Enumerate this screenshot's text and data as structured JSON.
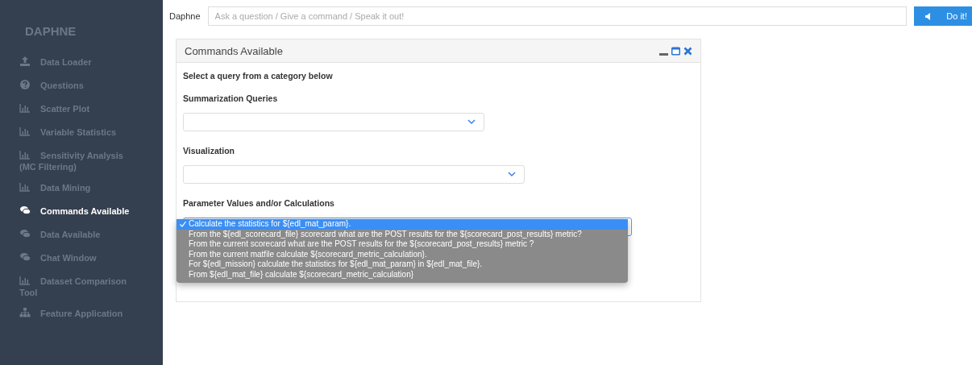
{
  "sidebar": {
    "title": "DAPHNE",
    "items": [
      {
        "label": "Data Loader",
        "kind": "upload",
        "selected": false
      },
      {
        "label": "Questions",
        "kind": "question",
        "selected": false
      },
      {
        "label": "Scatter Plot",
        "kind": "chart",
        "selected": false
      },
      {
        "label": "Variable Statistics",
        "kind": "chart",
        "selected": false
      },
      {
        "label": "Sensitivity Analysis (MC Filtering)",
        "kind": "chart",
        "selected": false
      },
      {
        "label": "Data Mining",
        "kind": "chart",
        "selected": false
      },
      {
        "label": "Commands Available",
        "kind": "comments",
        "selected": true
      },
      {
        "label": "Data Available",
        "kind": "comments",
        "selected": false
      },
      {
        "label": "Chat Window",
        "kind": "comments",
        "selected": false
      },
      {
        "label": "Dataset Comparison Tool",
        "kind": "chart",
        "selected": false
      },
      {
        "label": "Feature Application",
        "kind": "sitemap",
        "selected": false
      }
    ]
  },
  "command_bar": {
    "label": "Daphne",
    "placeholder": "Ask a question / Give a command / Speak it out!",
    "button": "Do it!"
  },
  "panel": {
    "title": "Commands Available",
    "intro": "Select a query from a category below",
    "categories": [
      {
        "label": "Summarization Queries",
        "expanded": false
      },
      {
        "label": "Visualization",
        "expanded": false
      },
      {
        "label": "Parameter Values and/or Calculations",
        "expanded": true,
        "options": [
          {
            "label": "Calculate the statistics for ${edl_mat_param}.",
            "selected": true
          },
          {
            "label": "From the ${edl_scorecard_file} scorecard what are the POST results for the ${scorecard_post_results} metric?",
            "selected": false
          },
          {
            "label": "From the current scorecard what are the POST results for the ${scorecard_post_results} metric ?",
            "selected": false
          },
          {
            "label": "From the current matfile calculate ${scorecard_metric_calculation}.",
            "selected": false
          },
          {
            "label": "For ${edl_mission} calculate the statistics for ${edl_mat_param} in ${edl_mat_file}.",
            "selected": false
          },
          {
            "label": "From ${edl_mat_file} calculate ${scorecard_metric_calculation}",
            "selected": false
          }
        ]
      }
    ]
  }
}
